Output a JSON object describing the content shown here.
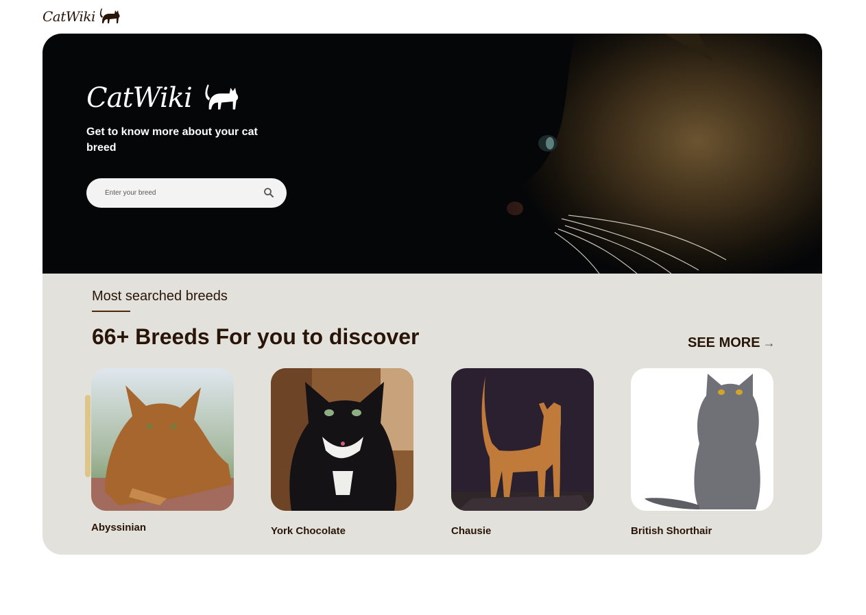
{
  "header": {
    "logo_text": "CatWiki"
  },
  "hero": {
    "logo_text": "CatWiki",
    "tagline": "Get to know more about your cat breed",
    "search": {
      "placeholder": "Enter your breed",
      "value": ""
    }
  },
  "breeds": {
    "section_label": "Most searched breeds",
    "heading": "66+ Breeds For you to discover",
    "see_more_label": "SEE MORE",
    "arrow": "→",
    "cards": [
      {
        "name": "Abyssinian"
      },
      {
        "name": "York Chocolate"
      },
      {
        "name": "Chausie"
      },
      {
        "name": "British Shorthair"
      }
    ]
  },
  "colors": {
    "brand_dark": "#291507",
    "hero_bg": "#050608",
    "section_bg": "#e3e1dc",
    "search_bg": "#f3f3f3"
  },
  "icons": [
    "cat-logo-icon",
    "search-icon",
    "arrow-right-icon"
  ]
}
